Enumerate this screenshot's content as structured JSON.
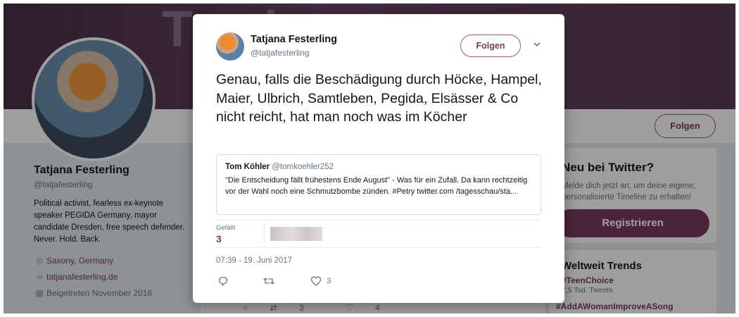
{
  "background": {
    "banner_text": "To        d   .",
    "follow_label": "Folgen",
    "profile": {
      "name": "Tatjana Festerling",
      "handle": "@tatjafesterling",
      "bio": "Political activist, fearless ex-keynote speaker PEGIDA Germany, mayor candidate Dresden, free speech defender. Never. Hold. Back.",
      "location": "Saxony, Germany",
      "website": "tatjanafesterling.de",
      "joined": "Beigetreten November 2016"
    },
    "signup": {
      "title": "Neu bei Twitter?",
      "text": "Melde dich jetzt an, um deine eigene, personalisierte Timeline zu erhalten!",
      "button": "Registrieren"
    },
    "trends": {
      "title": "Weltweit Trends",
      "items": [
        {
          "tag": "#TeenChoice",
          "count": "7,5 Tsd. Tweets"
        },
        {
          "tag": "#AddAWomanImproveASong",
          "count": ""
        }
      ]
    },
    "feed_actions": {
      "retweets": "3",
      "likes": "4"
    }
  },
  "modal": {
    "name": "Tatjana Festerling",
    "handle": "@tatjafesterling",
    "follow_label": "Folgen",
    "tweet_text": "Genau, falls die Beschädigung durch Höcke, Hampel, Maier, Ulbrich, Samtleben, Pegida, Elsässer & Co nicht reicht, hat man noch was im Köcher",
    "quote": {
      "name": "Tom Köhler",
      "handle": "@tomkoehler252",
      "text": "\"Die Entscheidung fällt frühestens Ende August\" - Was für ein Zufall. Da kann rechtzeitig vor der Wahl noch eine Schmutzbombe zünden. #Petry twitter.com /tagesschau/sta..."
    },
    "likes_label": "Gefällt",
    "likes_count": "3",
    "timestamp": "07:39 - 19. Juni 2017",
    "action_like_count": "3"
  },
  "colors": {
    "accent": "#7a3b5c",
    "muted": "#657786"
  }
}
